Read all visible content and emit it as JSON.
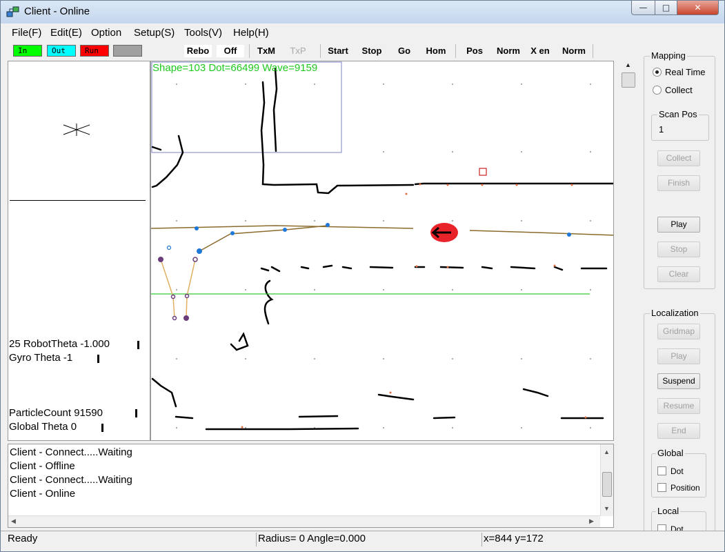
{
  "window": {
    "title": "Client - Online",
    "controls": {
      "minimize": "—",
      "maximize": "□",
      "close": "✕"
    }
  },
  "menubar": {
    "items": [
      "File(F)",
      "Edit(E)",
      "Option",
      "Setup(S)",
      "Tools(V)",
      "Help(H)"
    ]
  },
  "toolbar": {
    "indicators": [
      {
        "label": "In",
        "color": "#00ff00"
      },
      {
        "label": "Out",
        "color": "#00ffff"
      },
      {
        "label": "Run",
        "color": "#ff0000"
      },
      {
        "label": "",
        "color": "#a0a0a0"
      }
    ],
    "buttons": [
      "Rebo",
      "Off",
      "TxM",
      "TxP",
      "Start",
      "Stop",
      "Go",
      "Hom",
      "Pos",
      "Norm",
      "X en",
      "Norm"
    ]
  },
  "left_panel": {
    "robot_theta": "25 RobotTheta -1.000",
    "gyro_theta": "Gyro Theta -1",
    "particle_count": "ParticleCount 91590",
    "global_theta": "Global Theta 0"
  },
  "map": {
    "overlay": "Shape=103  Dot=66499  Wave=9159",
    "robot_color": "#e8242a",
    "path_color": "#8b6a2b",
    "line_color": "#33cc33"
  },
  "log": {
    "lines": [
      "Client - Connect.....Waiting",
      "Client - Offline",
      "Client - Connect.....Waiting",
      "Client - Online"
    ]
  },
  "statusbar": {
    "state": "Ready",
    "radius_angle": "Radius=  0 Angle=0.000",
    "coords": "x=844 y=172"
  },
  "right_panel": {
    "mapping": {
      "title": "Mapping",
      "real_time": "Real Time",
      "collect": "Collect",
      "scan_pos_title": "Scan Pos",
      "scan_pos_value": "1",
      "buttons": {
        "collect": "Collect",
        "finish": "Finish",
        "play": "Play",
        "stop": "Stop",
        "clear": "Clear"
      }
    },
    "localization": {
      "title": "Localization",
      "buttons": {
        "gridmap": "Gridmap",
        "play": "Play",
        "suspend": "Suspend",
        "resume": "Resume",
        "end": "End"
      },
      "global_title": "Global",
      "global_dot": "Dot",
      "global_position": "Position",
      "local_title": "Local",
      "local_dot": "Dot"
    }
  }
}
